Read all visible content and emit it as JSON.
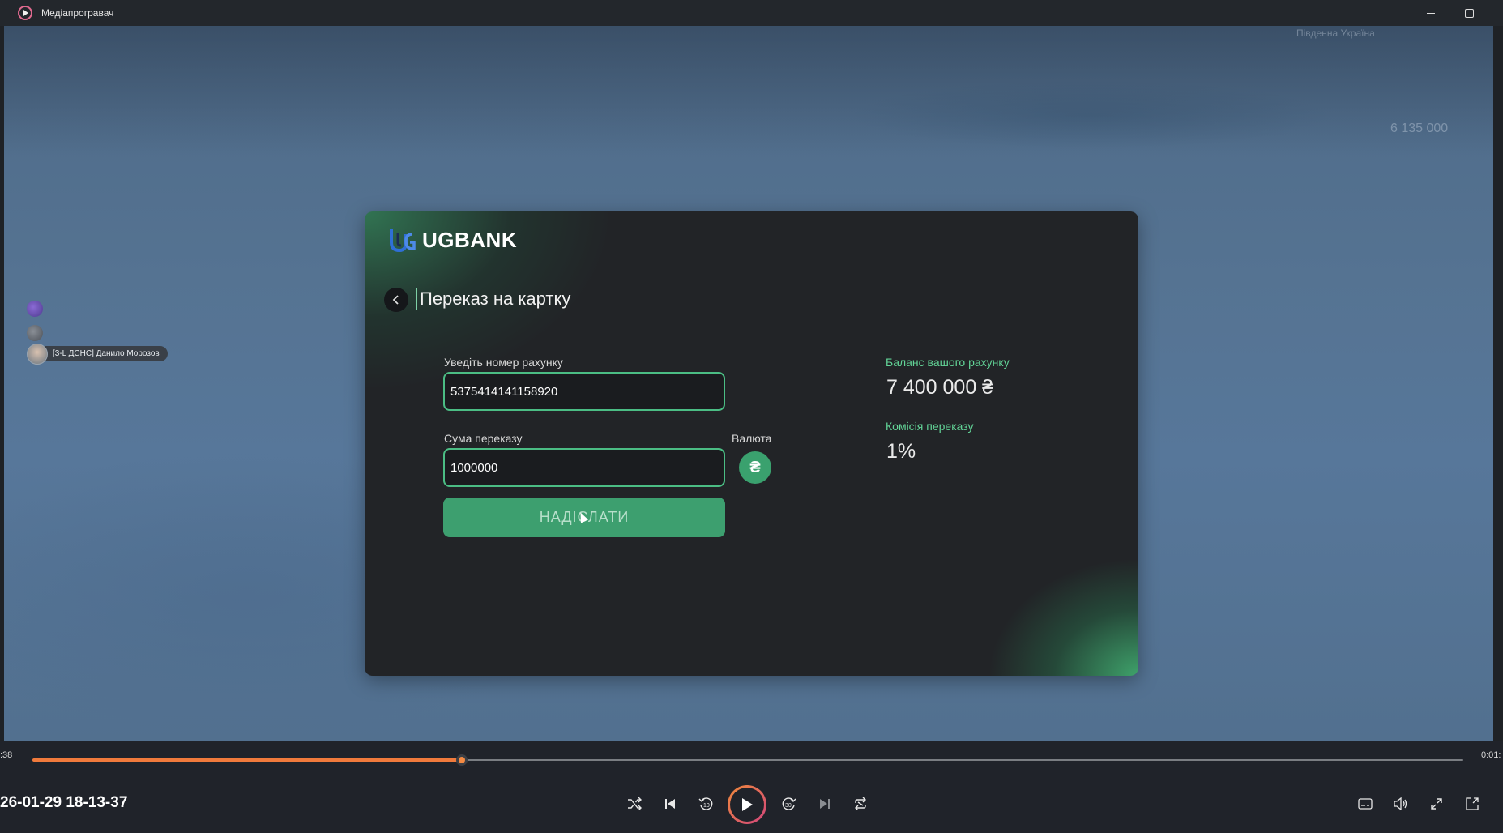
{
  "window": {
    "title": "Медіапрогравач",
    "app_icon": "play-circle-icon"
  },
  "scene": {
    "money_hud": "6 135 000",
    "region_hud": "Південна Україна",
    "player_tag": "[3-L ДСНС] Данило Морозов"
  },
  "bank": {
    "logo_text": "UGBANK",
    "page_title": "Переказ на картку",
    "account_label": "Уведіть номер рахунку",
    "account_value": "5375414141158920",
    "amount_label": "Сума переказу",
    "amount_value": "1000000",
    "currency_label": "Валюта",
    "currency_symbol": "₴",
    "send_label": "НАДІСЛАТИ",
    "balance_label": "Баланс вашого рахунку",
    "balance_value": "7 400 000 ₴",
    "fee_label": "Комісія переказу",
    "fee_value": "1%",
    "accent_color": "#4bbd84"
  },
  "player": {
    "time_elapsed": ":38",
    "time_total": "0:01:",
    "progress": 0.3,
    "media_title": "26-01-29 18-13-37",
    "buttons": [
      "shuffle-icon",
      "previous-icon",
      "rewind-10-icon",
      "play-icon",
      "forward-30-icon",
      "next-icon",
      "repeat-icon",
      "subtitles-icon",
      "volume-icon",
      "fullscreen-icon",
      "mini-player-icon"
    ],
    "progress_color": "#f07a3c"
  }
}
